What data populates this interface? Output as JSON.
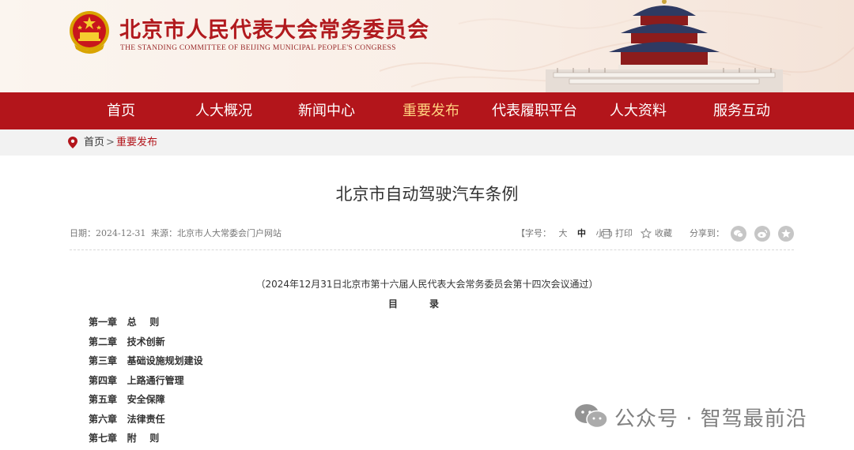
{
  "header": {
    "title": "北京市人民代表大会常务委员会",
    "subtitle": "THE STANDING COMMITTEE OF BEIJING MUNICIPAL PEOPLE'S CONGRESS"
  },
  "nav": {
    "items": [
      "首页",
      "人大概况",
      "新闻中心",
      "重要发布",
      "代表履职平台",
      "人大资料",
      "服务互动"
    ],
    "active_index": 3
  },
  "breadcrumb": {
    "home": "首页",
    "separator": ">",
    "current": "重要发布"
  },
  "article": {
    "title": "北京市自动驾驶汽车条例",
    "date_text": "日期：2024-12-31",
    "source_text": "来源：北京市人大常委会门户网站",
    "font_size_label": "【字号：",
    "font_sizes": [
      "大",
      "中",
      "小"
    ],
    "font_size_close": "】",
    "print_label": "打印",
    "favorite_label": "收藏",
    "share_label": "分享到：",
    "share_icons": [
      "wechat-icon",
      "weibo-icon",
      "star-icon"
    ],
    "subtitle": "（2024年12月31日北京市第十六届人民代表大会常务委员会第十四次会议通过）",
    "toc_title": "目录",
    "chapters": [
      {
        "num": "第一章",
        "title": "总    则"
      },
      {
        "num": "第二章",
        "title": "技术创新"
      },
      {
        "num": "第三章",
        "title": "基础设施规划建设"
      },
      {
        "num": "第四章",
        "title": "上路通行管理"
      },
      {
        "num": "第五章",
        "title": "安全保障"
      },
      {
        "num": "第六章",
        "title": "法律责任"
      },
      {
        "num": "第七章",
        "title": "附    则"
      }
    ]
  },
  "watermark": "公众号 · 智驾最前沿",
  "colors": {
    "brand_red": "#b3151b",
    "nav_active": "#ffd27f"
  }
}
